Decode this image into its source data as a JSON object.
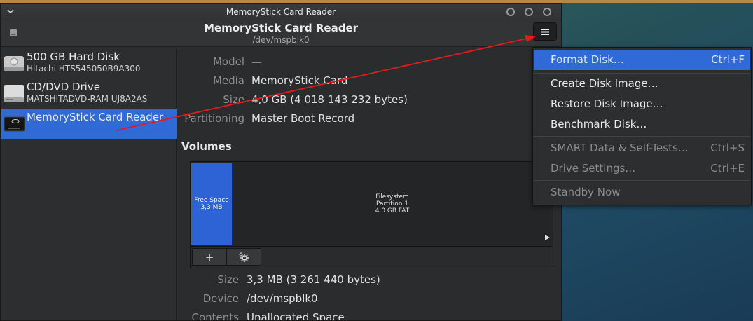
{
  "window": {
    "title": "MemoryStick Card Reader"
  },
  "header": {
    "title": "MemoryStick Card Reader",
    "subtitle": "/dev/mspblk0"
  },
  "sidebar": {
    "items": [
      {
        "name": "500 GB Hard Disk",
        "detail": "Hitachi HTS545050B9A300",
        "selected": false
      },
      {
        "name": "CD/DVD Drive",
        "detail": "MATSHITADVD-RAM UJ8A2AS",
        "selected": false
      },
      {
        "name": "MemoryStick Card Reader",
        "detail": "",
        "selected": true
      }
    ]
  },
  "drive": {
    "model_label": "Model",
    "model": "—",
    "media_label": "Media",
    "media": "MemoryStick Card",
    "size_label": "Size",
    "size": "4,0 GB (4 018 143 232 bytes)",
    "partitioning_label": "Partitioning",
    "partitioning": "Master Boot Record"
  },
  "volumes": {
    "title": "Volumes",
    "free": {
      "line1": "Free Space",
      "line2": "3,3 MB"
    },
    "fs": {
      "line1": "Filesystem",
      "line2": "Partition 1",
      "line3": "4,0 GB FAT"
    },
    "add_label": "+"
  },
  "selected_volume": {
    "size_label": "Size",
    "size": "3,3 MB (3 261 440 bytes)",
    "device_label": "Device",
    "device": "/dev/mspblk0",
    "contents_label": "Contents",
    "contents": "Unallocated Space"
  },
  "menu": {
    "items": [
      {
        "label": "Format Disk…",
        "shortcut": "Ctrl+F",
        "active": true,
        "disabled": false
      },
      {
        "label": "Create Disk Image…",
        "shortcut": "",
        "active": false,
        "disabled": false
      },
      {
        "label": "Restore Disk Image…",
        "shortcut": "",
        "active": false,
        "disabled": false
      },
      {
        "label": "Benchmark Disk…",
        "shortcut": "",
        "active": false,
        "disabled": false
      },
      {
        "label": "SMART Data & Self-Tests…",
        "shortcut": "Ctrl+S",
        "active": false,
        "disabled": true
      },
      {
        "label": "Drive Settings…",
        "shortcut": "Ctrl+E",
        "active": false,
        "disabled": true
      },
      {
        "label": "Standby Now",
        "shortcut": "",
        "active": false,
        "disabled": true
      }
    ]
  },
  "colors": {
    "accent": "#2f6ad6",
    "annotation_arrow": "#e21b1b"
  },
  "icons": [
    "chevron-down-icon",
    "drive-icon",
    "hard-disk-icon",
    "optical-drive-icon",
    "card-reader-icon",
    "hamburger-menu-icon",
    "gear-icon"
  ]
}
